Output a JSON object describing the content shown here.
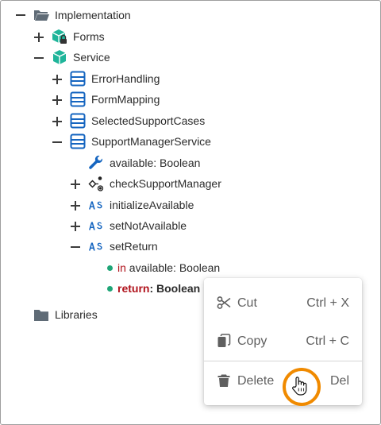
{
  "tree": {
    "implementation": "Implementation",
    "forms": "Forms",
    "service": "Service",
    "error_handling": "ErrorHandling",
    "form_mapping": "FormMapping",
    "selected_support_cases": "SelectedSupportCases",
    "support_manager_service": "SupportManagerService",
    "available": "available: Boolean",
    "check_support_manager": "checkSupportManager",
    "initialize_available": "initializeAvailable",
    "set_not_available": "setNotAvailable",
    "set_return": "setReturn",
    "param_in_kw": "in",
    "param_in_rest": "available: Boolean",
    "param_ret_kw": "return",
    "param_ret_rest": ": Boolean",
    "libraries": "Libraries"
  },
  "context_menu": {
    "cut": {
      "label": "Cut",
      "shortcut": "Ctrl + X"
    },
    "copy": {
      "label": "Copy",
      "shortcut": "Ctrl + C"
    },
    "delete": {
      "label": "Delete",
      "shortcut": "Del"
    }
  },
  "colors": {
    "teal": "#1fb59a",
    "blue": "#1565c0",
    "accent": "#f08a00",
    "keyword_red": "#b0121b"
  }
}
